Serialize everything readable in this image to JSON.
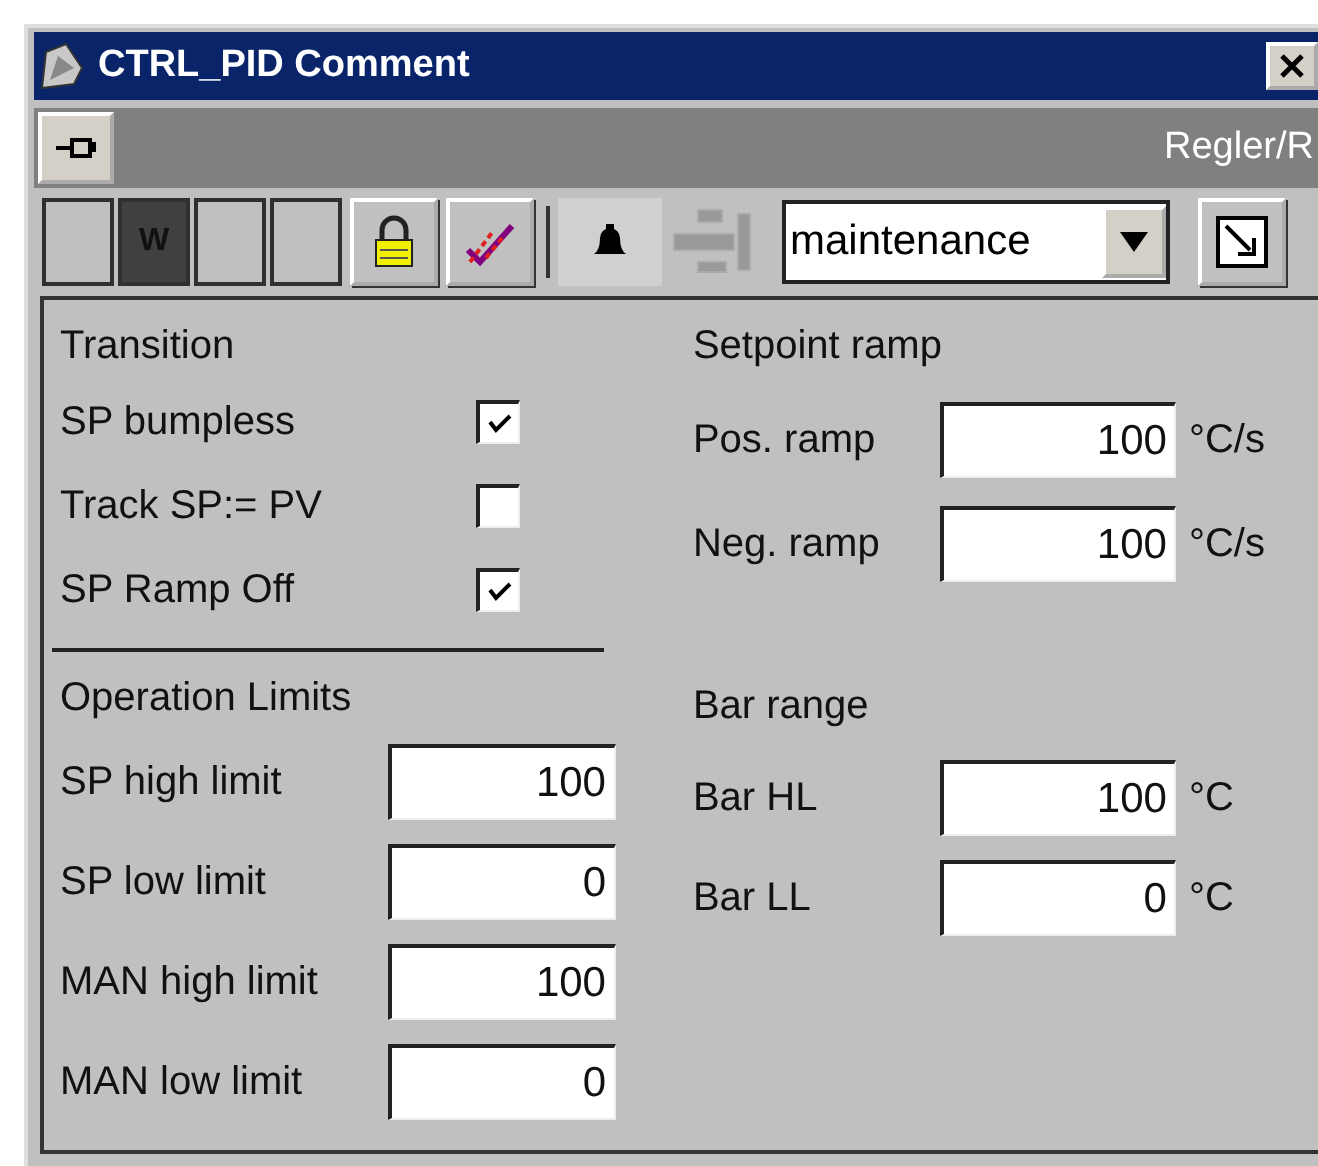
{
  "window": {
    "title": "CTRL_PID Comment"
  },
  "header": {
    "path": "Regler/R"
  },
  "toolbar": {
    "status_cells": [
      {
        "active": false
      },
      {
        "active": true,
        "label": "W"
      },
      {
        "active": false
      },
      {
        "active": false
      }
    ],
    "mode": "maintenance"
  },
  "transition": {
    "title": "Transition",
    "options": [
      {
        "label": "SP bumpless",
        "checked": true
      },
      {
        "label": "Track SP:= PV",
        "checked": false
      },
      {
        "label": "SP Ramp Off",
        "checked": true
      }
    ]
  },
  "operation_limits": {
    "title": "Operation Limits",
    "fields": [
      {
        "label": "SP high limit",
        "value": "100"
      },
      {
        "label": "SP low limit",
        "value": "0"
      },
      {
        "label": "MAN high limit",
        "value": "100"
      },
      {
        "label": "MAN low limit",
        "value": "0"
      }
    ]
  },
  "setpoint_ramp": {
    "title": "Setpoint ramp",
    "fields": [
      {
        "label": "Pos. ramp",
        "value": "100",
        "unit": "°C/s"
      },
      {
        "label": "Neg. ramp",
        "value": "100",
        "unit": "°C/s"
      }
    ]
  },
  "bar_range": {
    "title": "Bar range",
    "fields": [
      {
        "label": "Bar HL",
        "value": "100",
        "unit": "°C"
      },
      {
        "label": "Bar LL",
        "value": "0",
        "unit": "°C"
      }
    ]
  }
}
